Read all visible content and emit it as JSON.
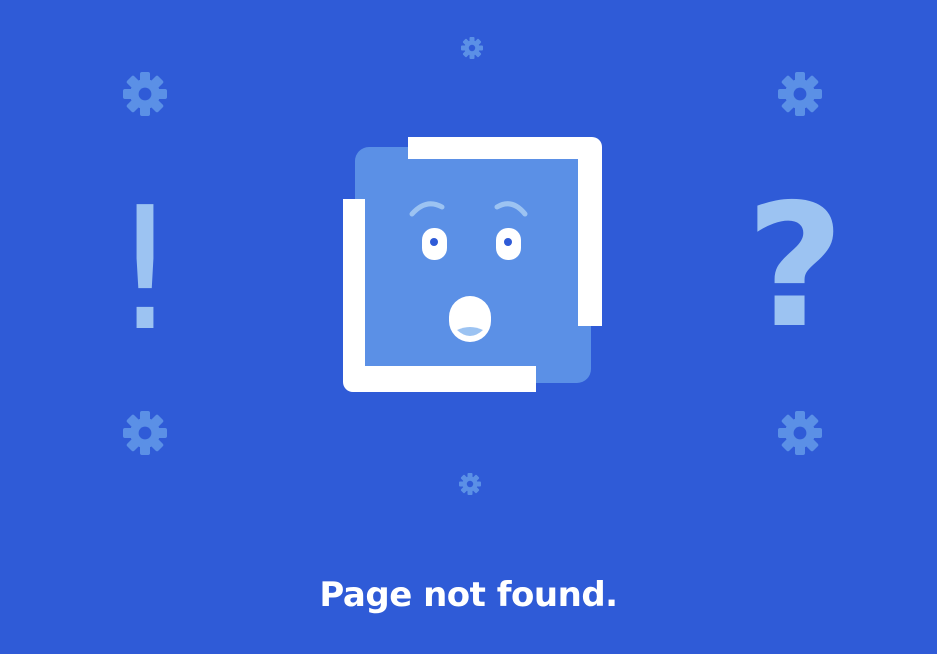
{
  "page": {
    "background_color": "#2f5bd7",
    "message": "Page not found."
  },
  "decorations": {
    "left_symbol": "!",
    "right_symbol": "?",
    "symbol_color": "#9cc3f2",
    "gear_color": "#5b90e6",
    "gear_icons": [
      "gear-icon",
      "gear-icon",
      "gear-icon",
      "gear-icon",
      "gear-icon",
      "gear-icon"
    ]
  },
  "illustration": {
    "icon": "surprised-face-icon",
    "face_color": "#5b90e6",
    "frame_color": "#ffffff"
  }
}
